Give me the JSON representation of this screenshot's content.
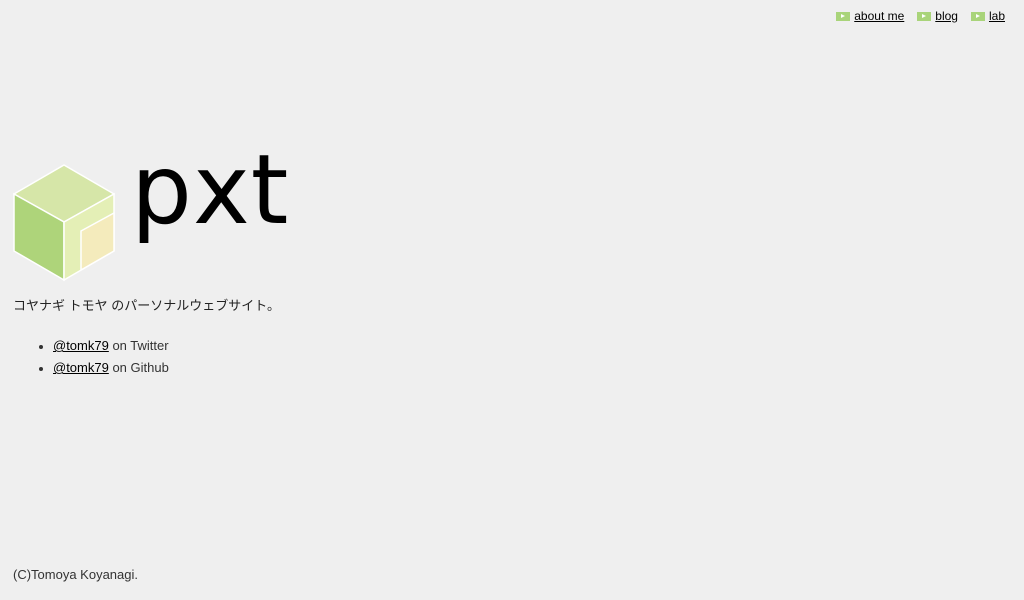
{
  "nav": {
    "items": [
      {
        "label": "about me",
        "icon": "play-icon"
      },
      {
        "label": "blog",
        "icon": "play-icon"
      },
      {
        "label": "lab",
        "icon": "play-icon"
      }
    ]
  },
  "logo": {
    "wordmark": "pxt",
    "icon": "cube-icon",
    "colors": {
      "top": "#d6e6a8",
      "left": "#aed47a",
      "right": "#e4efb6",
      "inner": "#f4ebbc"
    }
  },
  "tagline": "コヤナギ トモヤ のパーソナルウェブサイト。",
  "links": [
    {
      "handle": "@tomk79",
      "suffix": " on Twitter"
    },
    {
      "handle": "@tomk79",
      "suffix": " on Github"
    }
  ],
  "footer": "(C)Tomoya Koyanagi.",
  "colors": {
    "background": "#efefef",
    "accent": "#a9d47a"
  }
}
